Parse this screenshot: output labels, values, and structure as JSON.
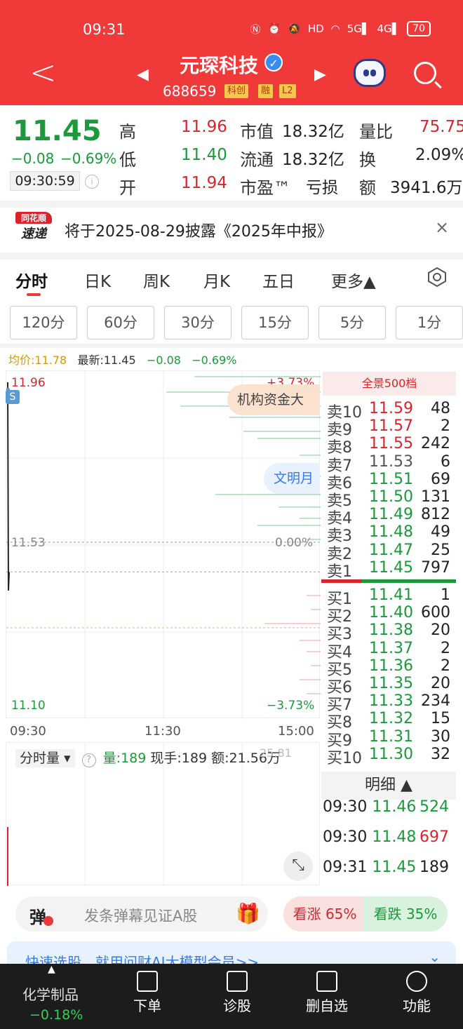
{
  "status_bar": {
    "time": "09:31",
    "icons": [
      "N",
      "alarm",
      "mute",
      "HD",
      "wifi",
      "5G",
      "4G"
    ],
    "battery": "70"
  },
  "header": {
    "name": "元琛科技",
    "code": "688659",
    "tags": [
      "科创",
      "融",
      "L2"
    ]
  },
  "quote": {
    "price": "11.45",
    "change": "−0.08",
    "change_pct": "−0.69%",
    "time": "09:30:59",
    "rows": [
      [
        {
          "label": "高",
          "value": "11.96",
          "color": "#d7262b"
        },
        {
          "label": "市值",
          "value": "18.32亿",
          "color": "#222"
        },
        {
          "label": "量比",
          "value": "75.75",
          "color": "#d7262b"
        }
      ],
      [
        {
          "label": "低",
          "value": "11.40",
          "color": "#1a9a3a"
        },
        {
          "label": "流通",
          "value": "18.32亿",
          "color": "#222"
        },
        {
          "label": "换",
          "value": "2.09%",
          "color": "#222"
        }
      ],
      [
        {
          "label": "开",
          "value": "11.94",
          "color": "#d7262b"
        },
        {
          "label": "市盈™",
          "value": "亏损",
          "color": "#222"
        },
        {
          "label": "额",
          "value": "3941.6万",
          "color": "#222"
        }
      ]
    ]
  },
  "banner": {
    "logo_top": "同花顺",
    "logo_bottom": "速递",
    "text": "将于2025-08-29披露《2025年中报》",
    "close": "×"
  },
  "tabs": [
    "分时",
    "日K",
    "周K",
    "月K",
    "五日",
    "更多▲"
  ],
  "intervals": [
    "120分",
    "60分",
    "30分",
    "15分",
    "5分",
    "1分"
  ],
  "chart_head": {
    "avg": "均价:11.78",
    "latest": "最新:11.45",
    "chg": "−0.08",
    "pct": "−0.69%"
  },
  "chart_data": {
    "type": "line",
    "y_labels": {
      "top": "11.96",
      "mid": "11.53",
      "bottom": "11.10"
    },
    "pct_labels": {
      "top": "+3.73%",
      "mid": "0.00%",
      "bottom": "−3.73%"
    },
    "x_labels": [
      "09:30",
      "11:30",
      "15:00"
    ],
    "series": [
      {
        "x": [
          "09:30",
          "09:30",
          "09:30",
          "09:31"
        ],
        "values": [
          11.94,
          11.96,
          11.4,
          11.45
        ]
      }
    ],
    "ylim": [
      11.1,
      11.96
    ]
  },
  "overlays": {
    "s_marker": "S",
    "institutional": "机构资金大",
    "wenming": "文明月"
  },
  "order_book": {
    "title": "全景500档",
    "asks": [
      {
        "label": "卖10",
        "price": "11.59",
        "vol": "48",
        "color": "#d7262b"
      },
      {
        "label": "卖9",
        "price": "11.57",
        "vol": "2",
        "color": "#d7262b"
      },
      {
        "label": "卖8",
        "price": "11.55",
        "vol": "242",
        "color": "#d7262b"
      },
      {
        "label": "卖7",
        "price": "11.53",
        "vol": "6",
        "color": "#555"
      },
      {
        "label": "卖6",
        "price": "11.51",
        "vol": "69",
        "color": "#1a9a3a"
      },
      {
        "label": "卖5",
        "price": "11.50",
        "vol": "131",
        "color": "#1a9a3a"
      },
      {
        "label": "卖4",
        "price": "11.49",
        "vol": "812",
        "color": "#1a9a3a"
      },
      {
        "label": "卖3",
        "price": "11.48",
        "vol": "49",
        "color": "#1a9a3a"
      },
      {
        "label": "卖2",
        "price": "11.47",
        "vol": "25",
        "color": "#1a9a3a"
      },
      {
        "label": "卖1",
        "price": "11.45",
        "vol": "797",
        "color": "#1a9a3a"
      }
    ],
    "bids": [
      {
        "label": "买1",
        "price": "11.41",
        "vol": "1",
        "color": "#1a9a3a"
      },
      {
        "label": "买2",
        "price": "11.40",
        "vol": "600",
        "color": "#1a9a3a"
      },
      {
        "label": "买3",
        "price": "11.38",
        "vol": "20",
        "color": "#1a9a3a"
      },
      {
        "label": "买4",
        "price": "11.37",
        "vol": "2",
        "color": "#1a9a3a"
      },
      {
        "label": "买5",
        "price": "11.36",
        "vol": "2",
        "color": "#1a9a3a"
      },
      {
        "label": "买6",
        "price": "11.35",
        "vol": "20",
        "color": "#1a9a3a"
      },
      {
        "label": "买7",
        "price": "11.33",
        "vol": "234",
        "color": "#1a9a3a"
      },
      {
        "label": "买8",
        "price": "11.32",
        "vol": "15",
        "color": "#1a9a3a"
      },
      {
        "label": "买9",
        "price": "11.31",
        "vol": "30",
        "color": "#1a9a3a"
      },
      {
        "label": "买10",
        "price": "11.30",
        "vol": "32",
        "color": "#1a9a3a"
      }
    ]
  },
  "detail": {
    "title": "明细 ▲",
    "rows": [
      {
        "time": "09:30",
        "price": "11.46",
        "vol": "524",
        "vcolor": "#1a9a3a"
      },
      {
        "time": "09:30",
        "price": "11.48",
        "vol": "697",
        "vcolor": "#d7262b"
      },
      {
        "time": "09:31",
        "price": "11.45",
        "vol": "189",
        "vcolor": "#222"
      }
    ]
  },
  "volume_panel": {
    "selector": "分时量 ▾",
    "vol": "量:189",
    "hand": "现手:189",
    "amount": "额:21.56万",
    "ghost": "25.81"
  },
  "comment": {
    "icon": "弹",
    "placeholder": "发条弹幕见证A股"
  },
  "sentiment": {
    "up": "看涨 65%",
    "down": "看跌 35%"
  },
  "promo": "快速选股，就用问财AI大模型会员>>",
  "bottom": {
    "sector": "化学制品",
    "sector_chg": "−0.18%",
    "items": [
      "下单",
      "诊股",
      "删自选",
      "功能"
    ]
  }
}
